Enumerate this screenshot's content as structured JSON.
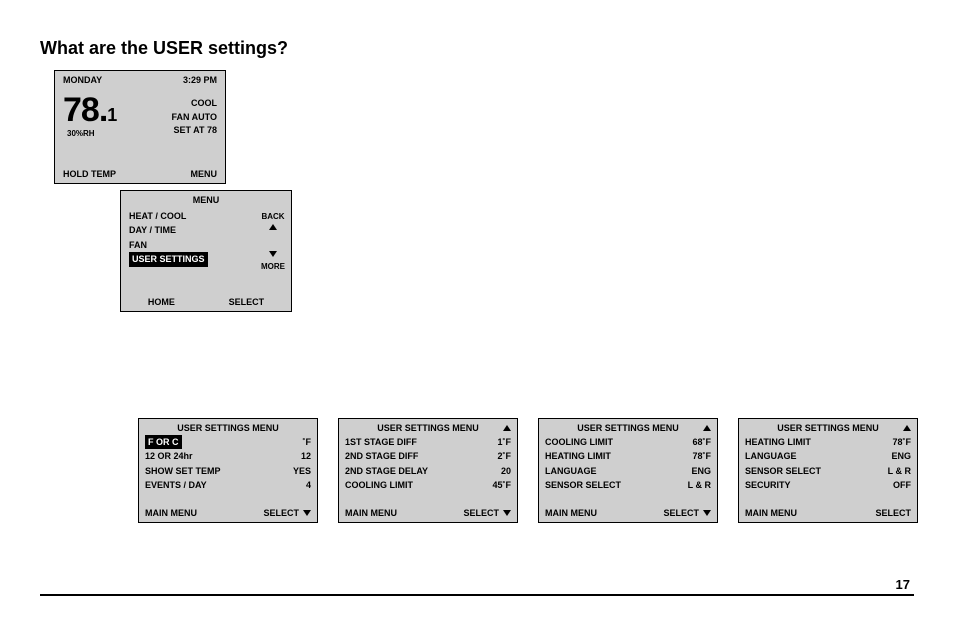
{
  "page": {
    "title": "What are the USER settings?",
    "number": "17"
  },
  "thermo": {
    "day": "MONDAY",
    "time": "3:29 PM",
    "temp_int": "78.",
    "temp_dec": "1",
    "rh": "30%RH",
    "cool": "COOL",
    "fan": "FAN AUTO",
    "setat": "SET AT 78",
    "hold": "HOLD TEMP",
    "menu": "MENU"
  },
  "menu": {
    "title": "MENU",
    "items": [
      "HEAT / COOL",
      "DAY / TIME",
      "FAN",
      "USER SETTINGS"
    ],
    "back": "BACK",
    "more": "MORE",
    "home": "HOME",
    "select": "SELECT"
  },
  "cards": [
    {
      "title": "USER SETTINGS MENU",
      "up": false,
      "down": true,
      "rows": [
        {
          "label": "F  OR  C",
          "value": "˚F",
          "selected": true
        },
        {
          "label": "12 OR 24hr",
          "value": "12"
        },
        {
          "label": "SHOW SET TEMP",
          "value": "YES"
        },
        {
          "label": "EVENTS / DAY",
          "value": "4"
        }
      ],
      "left": "MAIN MENU",
      "right": "SELECT"
    },
    {
      "title": "USER SETTINGS MENU",
      "up": true,
      "down": true,
      "rows": [
        {
          "label": "1ST STAGE DIFF",
          "value": "1˚F"
        },
        {
          "label": "2ND STAGE DIFF",
          "value": "2˚F"
        },
        {
          "label": "2ND STAGE DELAY",
          "value": "20"
        },
        {
          "label": "COOLING LIMIT",
          "value": "45˚F"
        }
      ],
      "left": "MAIN MENU",
      "right": "SELECT"
    },
    {
      "title": "USER SETTINGS MENU",
      "up": true,
      "down": true,
      "rows": [
        {
          "label": "COOLING LIMIT",
          "value": "68˚F"
        },
        {
          "label": "HEATING LIMIT",
          "value": "78˚F"
        },
        {
          "label": "LANGUAGE",
          "value": "ENG"
        },
        {
          "label": "SENSOR SELECT",
          "value": "L & R"
        }
      ],
      "left": "MAIN MENU",
      "right": "SELECT"
    },
    {
      "title": "USER SETTINGS MENU",
      "up": true,
      "down": false,
      "rows": [
        {
          "label": "HEATING LIMIT",
          "value": "78˚F"
        },
        {
          "label": "LANGUAGE",
          "value": "ENG"
        },
        {
          "label": "SENSOR SELECT",
          "value": "L & R"
        },
        {
          "label": "SECURITY",
          "value": "OFF"
        }
      ],
      "left": "MAIN MENU",
      "right": "SELECT"
    }
  ]
}
